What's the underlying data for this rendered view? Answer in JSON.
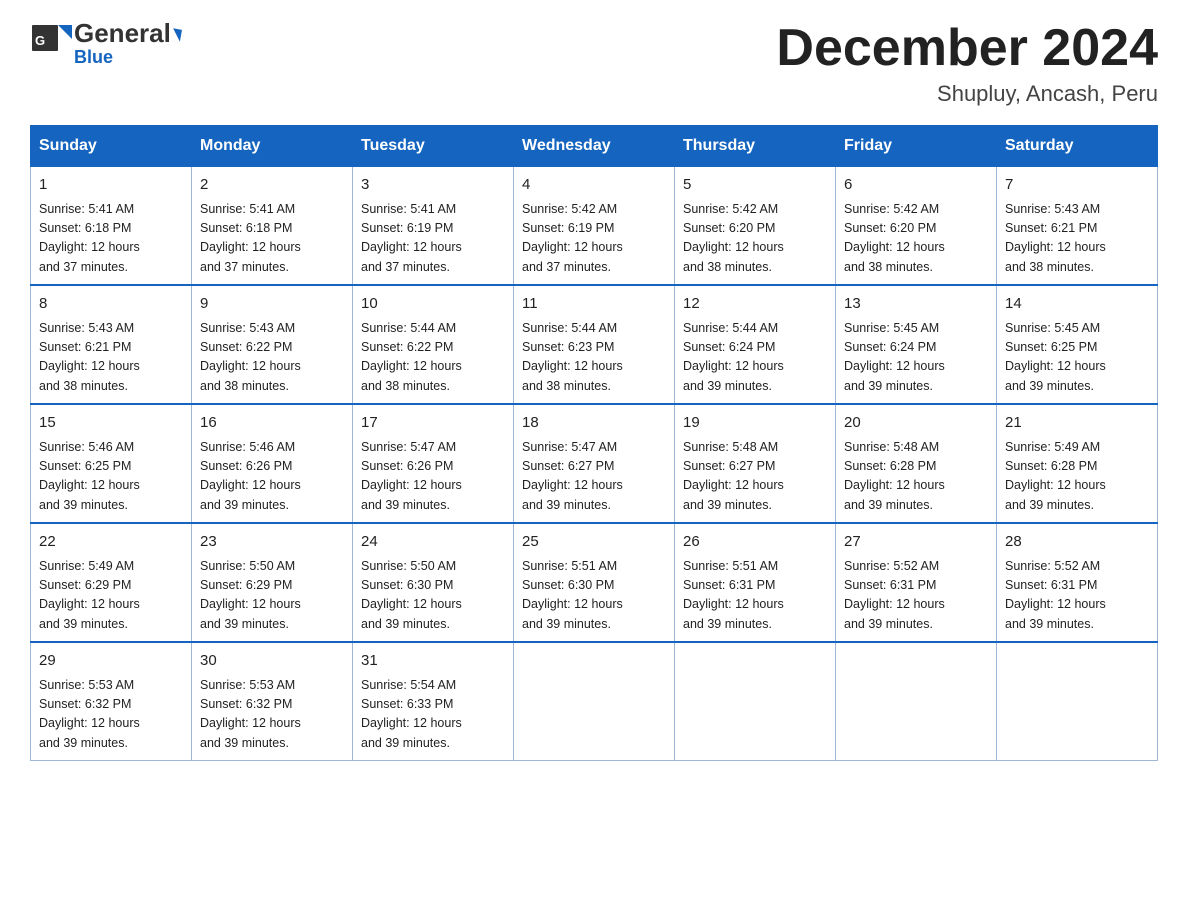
{
  "header": {
    "logo_general": "General",
    "logo_blue": "Blue",
    "title": "December 2024",
    "subtitle": "Shupluy, Ancash, Peru"
  },
  "days_of_week": [
    "Sunday",
    "Monday",
    "Tuesday",
    "Wednesday",
    "Thursday",
    "Friday",
    "Saturday"
  ],
  "weeks": [
    [
      {
        "day": "1",
        "sunrise": "5:41 AM",
        "sunset": "6:18 PM",
        "daylight": "12 hours and 37 minutes."
      },
      {
        "day": "2",
        "sunrise": "5:41 AM",
        "sunset": "6:18 PM",
        "daylight": "12 hours and 37 minutes."
      },
      {
        "day": "3",
        "sunrise": "5:41 AM",
        "sunset": "6:19 PM",
        "daylight": "12 hours and 37 minutes."
      },
      {
        "day": "4",
        "sunrise": "5:42 AM",
        "sunset": "6:19 PM",
        "daylight": "12 hours and 37 minutes."
      },
      {
        "day": "5",
        "sunrise": "5:42 AM",
        "sunset": "6:20 PM",
        "daylight": "12 hours and 38 minutes."
      },
      {
        "day": "6",
        "sunrise": "5:42 AM",
        "sunset": "6:20 PM",
        "daylight": "12 hours and 38 minutes."
      },
      {
        "day": "7",
        "sunrise": "5:43 AM",
        "sunset": "6:21 PM",
        "daylight": "12 hours and 38 minutes."
      }
    ],
    [
      {
        "day": "8",
        "sunrise": "5:43 AM",
        "sunset": "6:21 PM",
        "daylight": "12 hours and 38 minutes."
      },
      {
        "day": "9",
        "sunrise": "5:43 AM",
        "sunset": "6:22 PM",
        "daylight": "12 hours and 38 minutes."
      },
      {
        "day": "10",
        "sunrise": "5:44 AM",
        "sunset": "6:22 PM",
        "daylight": "12 hours and 38 minutes."
      },
      {
        "day": "11",
        "sunrise": "5:44 AM",
        "sunset": "6:23 PM",
        "daylight": "12 hours and 38 minutes."
      },
      {
        "day": "12",
        "sunrise": "5:44 AM",
        "sunset": "6:24 PM",
        "daylight": "12 hours and 39 minutes."
      },
      {
        "day": "13",
        "sunrise": "5:45 AM",
        "sunset": "6:24 PM",
        "daylight": "12 hours and 39 minutes."
      },
      {
        "day": "14",
        "sunrise": "5:45 AM",
        "sunset": "6:25 PM",
        "daylight": "12 hours and 39 minutes."
      }
    ],
    [
      {
        "day": "15",
        "sunrise": "5:46 AM",
        "sunset": "6:25 PM",
        "daylight": "12 hours and 39 minutes."
      },
      {
        "day": "16",
        "sunrise": "5:46 AM",
        "sunset": "6:26 PM",
        "daylight": "12 hours and 39 minutes."
      },
      {
        "day": "17",
        "sunrise": "5:47 AM",
        "sunset": "6:26 PM",
        "daylight": "12 hours and 39 minutes."
      },
      {
        "day": "18",
        "sunrise": "5:47 AM",
        "sunset": "6:27 PM",
        "daylight": "12 hours and 39 minutes."
      },
      {
        "day": "19",
        "sunrise": "5:48 AM",
        "sunset": "6:27 PM",
        "daylight": "12 hours and 39 minutes."
      },
      {
        "day": "20",
        "sunrise": "5:48 AM",
        "sunset": "6:28 PM",
        "daylight": "12 hours and 39 minutes."
      },
      {
        "day": "21",
        "sunrise": "5:49 AM",
        "sunset": "6:28 PM",
        "daylight": "12 hours and 39 minutes."
      }
    ],
    [
      {
        "day": "22",
        "sunrise": "5:49 AM",
        "sunset": "6:29 PM",
        "daylight": "12 hours and 39 minutes."
      },
      {
        "day": "23",
        "sunrise": "5:50 AM",
        "sunset": "6:29 PM",
        "daylight": "12 hours and 39 minutes."
      },
      {
        "day": "24",
        "sunrise": "5:50 AM",
        "sunset": "6:30 PM",
        "daylight": "12 hours and 39 minutes."
      },
      {
        "day": "25",
        "sunrise": "5:51 AM",
        "sunset": "6:30 PM",
        "daylight": "12 hours and 39 minutes."
      },
      {
        "day": "26",
        "sunrise": "5:51 AM",
        "sunset": "6:31 PM",
        "daylight": "12 hours and 39 minutes."
      },
      {
        "day": "27",
        "sunrise": "5:52 AM",
        "sunset": "6:31 PM",
        "daylight": "12 hours and 39 minutes."
      },
      {
        "day": "28",
        "sunrise": "5:52 AM",
        "sunset": "6:31 PM",
        "daylight": "12 hours and 39 minutes."
      }
    ],
    [
      {
        "day": "29",
        "sunrise": "5:53 AM",
        "sunset": "6:32 PM",
        "daylight": "12 hours and 39 minutes."
      },
      {
        "day": "30",
        "sunrise": "5:53 AM",
        "sunset": "6:32 PM",
        "daylight": "12 hours and 39 minutes."
      },
      {
        "day": "31",
        "sunrise": "5:54 AM",
        "sunset": "6:33 PM",
        "daylight": "12 hours and 39 minutes."
      },
      null,
      null,
      null,
      null
    ]
  ],
  "labels": {
    "sunrise_prefix": "Sunrise: ",
    "sunset_prefix": "Sunset: ",
    "daylight_prefix": "Daylight: "
  }
}
